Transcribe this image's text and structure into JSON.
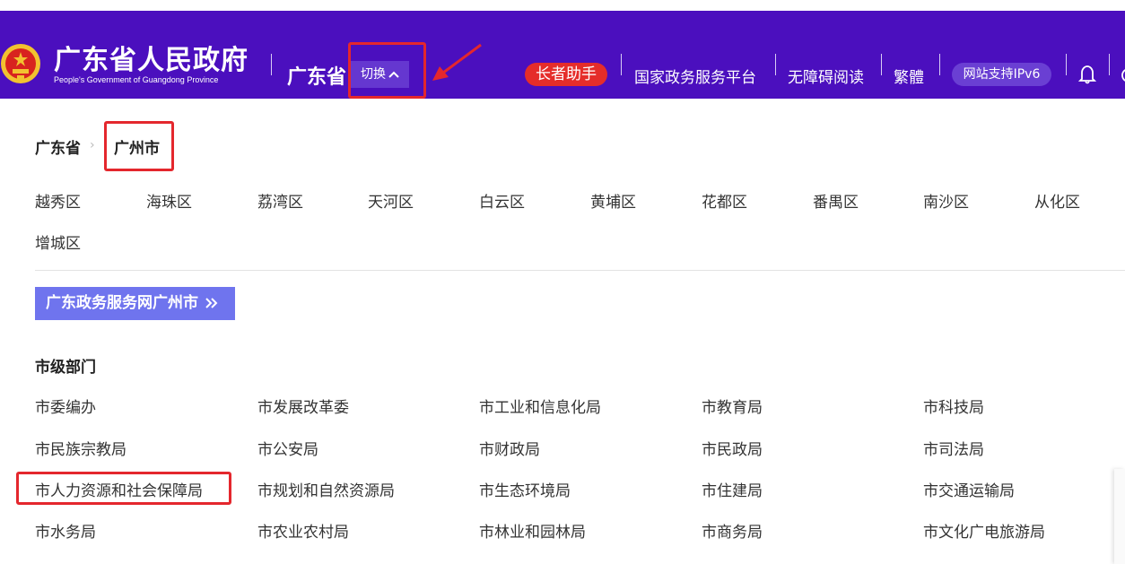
{
  "header": {
    "title": "广东省人民政府",
    "subtitle": "People's Government of Guangdong Province",
    "province": "广东省",
    "switch_label": "切换",
    "elder_assist": "长者助手",
    "nav": [
      "国家政务服务平台",
      "无障碍阅读",
      "繁體"
    ],
    "ipv6": "网站支持IPv6",
    "colors": {
      "background": "#4b0fbe",
      "elder_button": "#e52d2a",
      "highlight": "#e4272d"
    }
  },
  "breadcrumb": {
    "province": "广东省",
    "city": "广州市"
  },
  "districts": [
    "越秀区",
    "海珠区",
    "荔湾区",
    "天河区",
    "白云区",
    "黄埔区",
    "花都区",
    "番禺区",
    "南沙区",
    "从化区",
    "增城区"
  ],
  "portal_button": "广东政务服务网广州市",
  "section_title": "市级部门",
  "departments": [
    [
      "市委编办",
      "市发展改革委",
      "市工业和信息化局",
      "市教育局",
      "市科技局"
    ],
    [
      "市民族宗教局",
      "市公安局",
      "市财政局",
      "市民政局",
      "市司法局"
    ],
    [
      "市人力资源和社会保障局",
      "市规划和自然资源局",
      "市生态环境局",
      "市住建局",
      "市交通运输局"
    ],
    [
      "市水务局",
      "市农业农村局",
      "市林业和园林局",
      "市商务局",
      "市文化广电旅游局"
    ]
  ],
  "icons": [
    "national-emblem-icon",
    "chevron-up-icon",
    "bell-icon",
    "double-chevron-right-icon",
    "arrow-annotation-icon"
  ]
}
